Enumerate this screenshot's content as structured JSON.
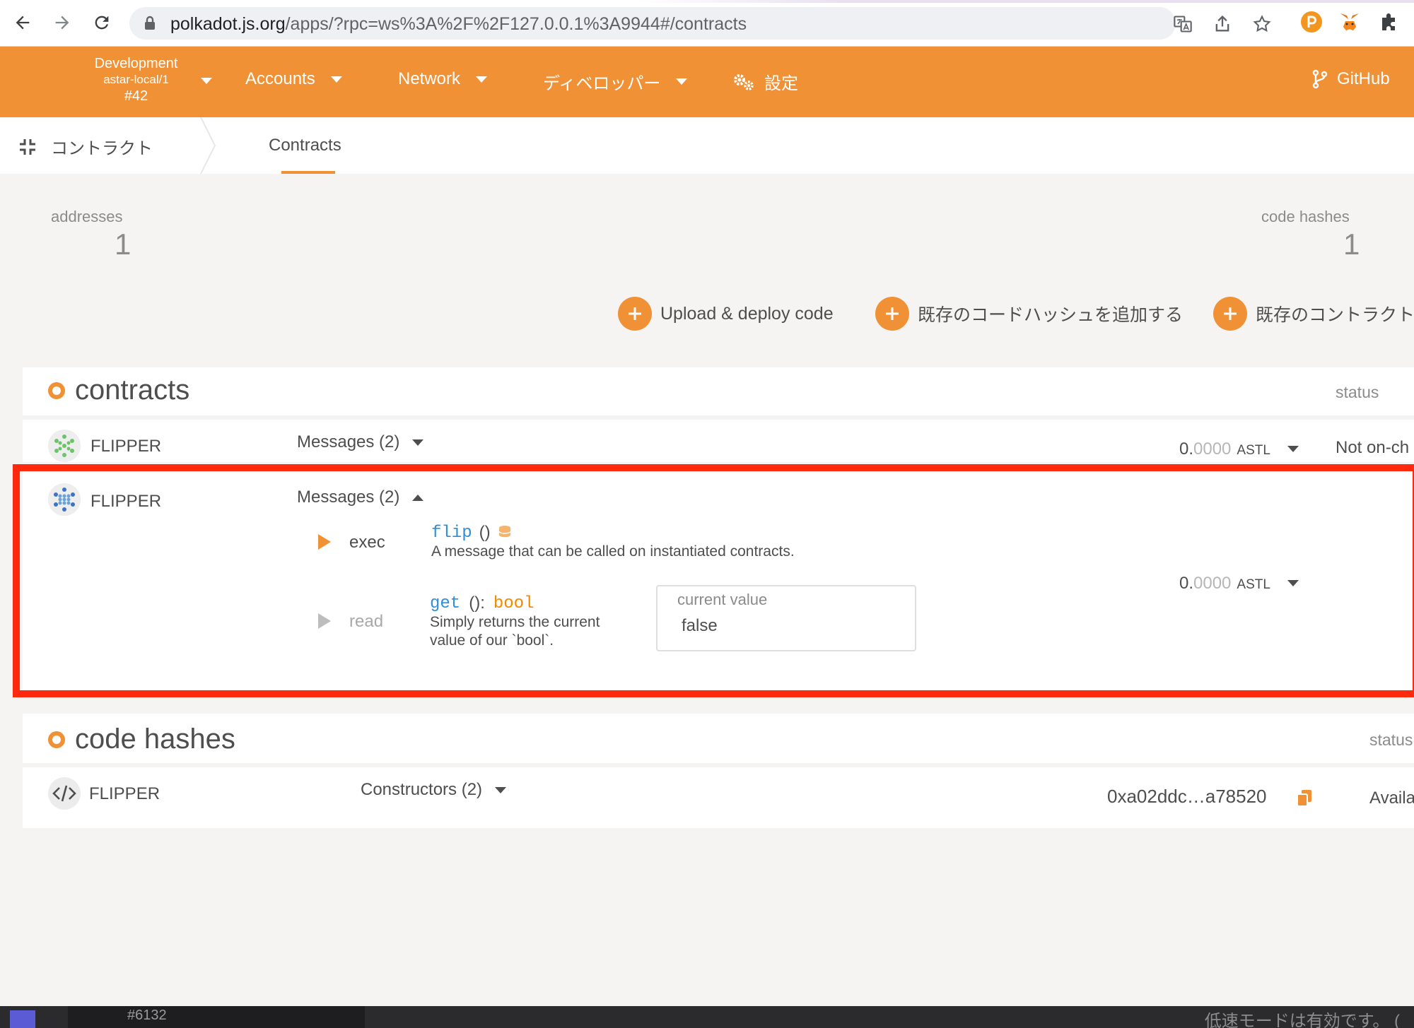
{
  "browser": {
    "url_host": "polkadot.js.org",
    "url_path": "/apps/?rpc=ws%3A%2F%2F127.0.0.1%3A9944#/contracts"
  },
  "header": {
    "chain_line1": "Development",
    "chain_line2": "astar-local/1",
    "chain_line3": "#42",
    "menu": {
      "accounts": "Accounts",
      "network": "Network",
      "developer": "ディベロッパー",
      "settings": "設定",
      "github": "GitHub"
    },
    "accent": "#f19135"
  },
  "subnav": {
    "section": "コントラクト",
    "tab": "Contracts"
  },
  "summary": {
    "addresses_label": "addresses",
    "addresses_value": "1",
    "codehashes_label": "code hashes",
    "codehashes_value": "1"
  },
  "actions": {
    "upload": "Upload & deploy code",
    "add_codehash": "既存のコードハッシュを追加する",
    "add_contract": "既存のコントラクト"
  },
  "contracts": {
    "title": "contracts",
    "status_header": "status",
    "rows": [
      {
        "name": "FLIPPER",
        "messages": "Messages (2)",
        "balance_int": "0.",
        "balance_dec": "0000",
        "balance_unit": "ASTL",
        "status": "Not on-ch"
      },
      {
        "name": "FLIPPER",
        "messages": "Messages (2)",
        "balance_int": "0.",
        "balance_dec": "0000",
        "balance_unit": "ASTL",
        "exec": {
          "kind": "exec",
          "method": "flip",
          "args": "()",
          "desc": "A message that can be called on instantiated contracts."
        },
        "read": {
          "kind": "read",
          "method": "get",
          "args": "():",
          "ret": "bool",
          "desc_line1": "Simply returns the current",
          "desc_line2": "value of our `bool`.",
          "value_label": "current value",
          "value": "false"
        }
      }
    ]
  },
  "codehashes": {
    "title": "code hashes",
    "status_header": "status",
    "rows": [
      {
        "name": "FLIPPER",
        "constructors": "Constructors (2)",
        "hash": "0xa02ddc…a78520",
        "status": "Availa"
      }
    ]
  },
  "taskbar": {
    "left_text": "#6132",
    "right_text": "低速モードは有効です。 ("
  }
}
